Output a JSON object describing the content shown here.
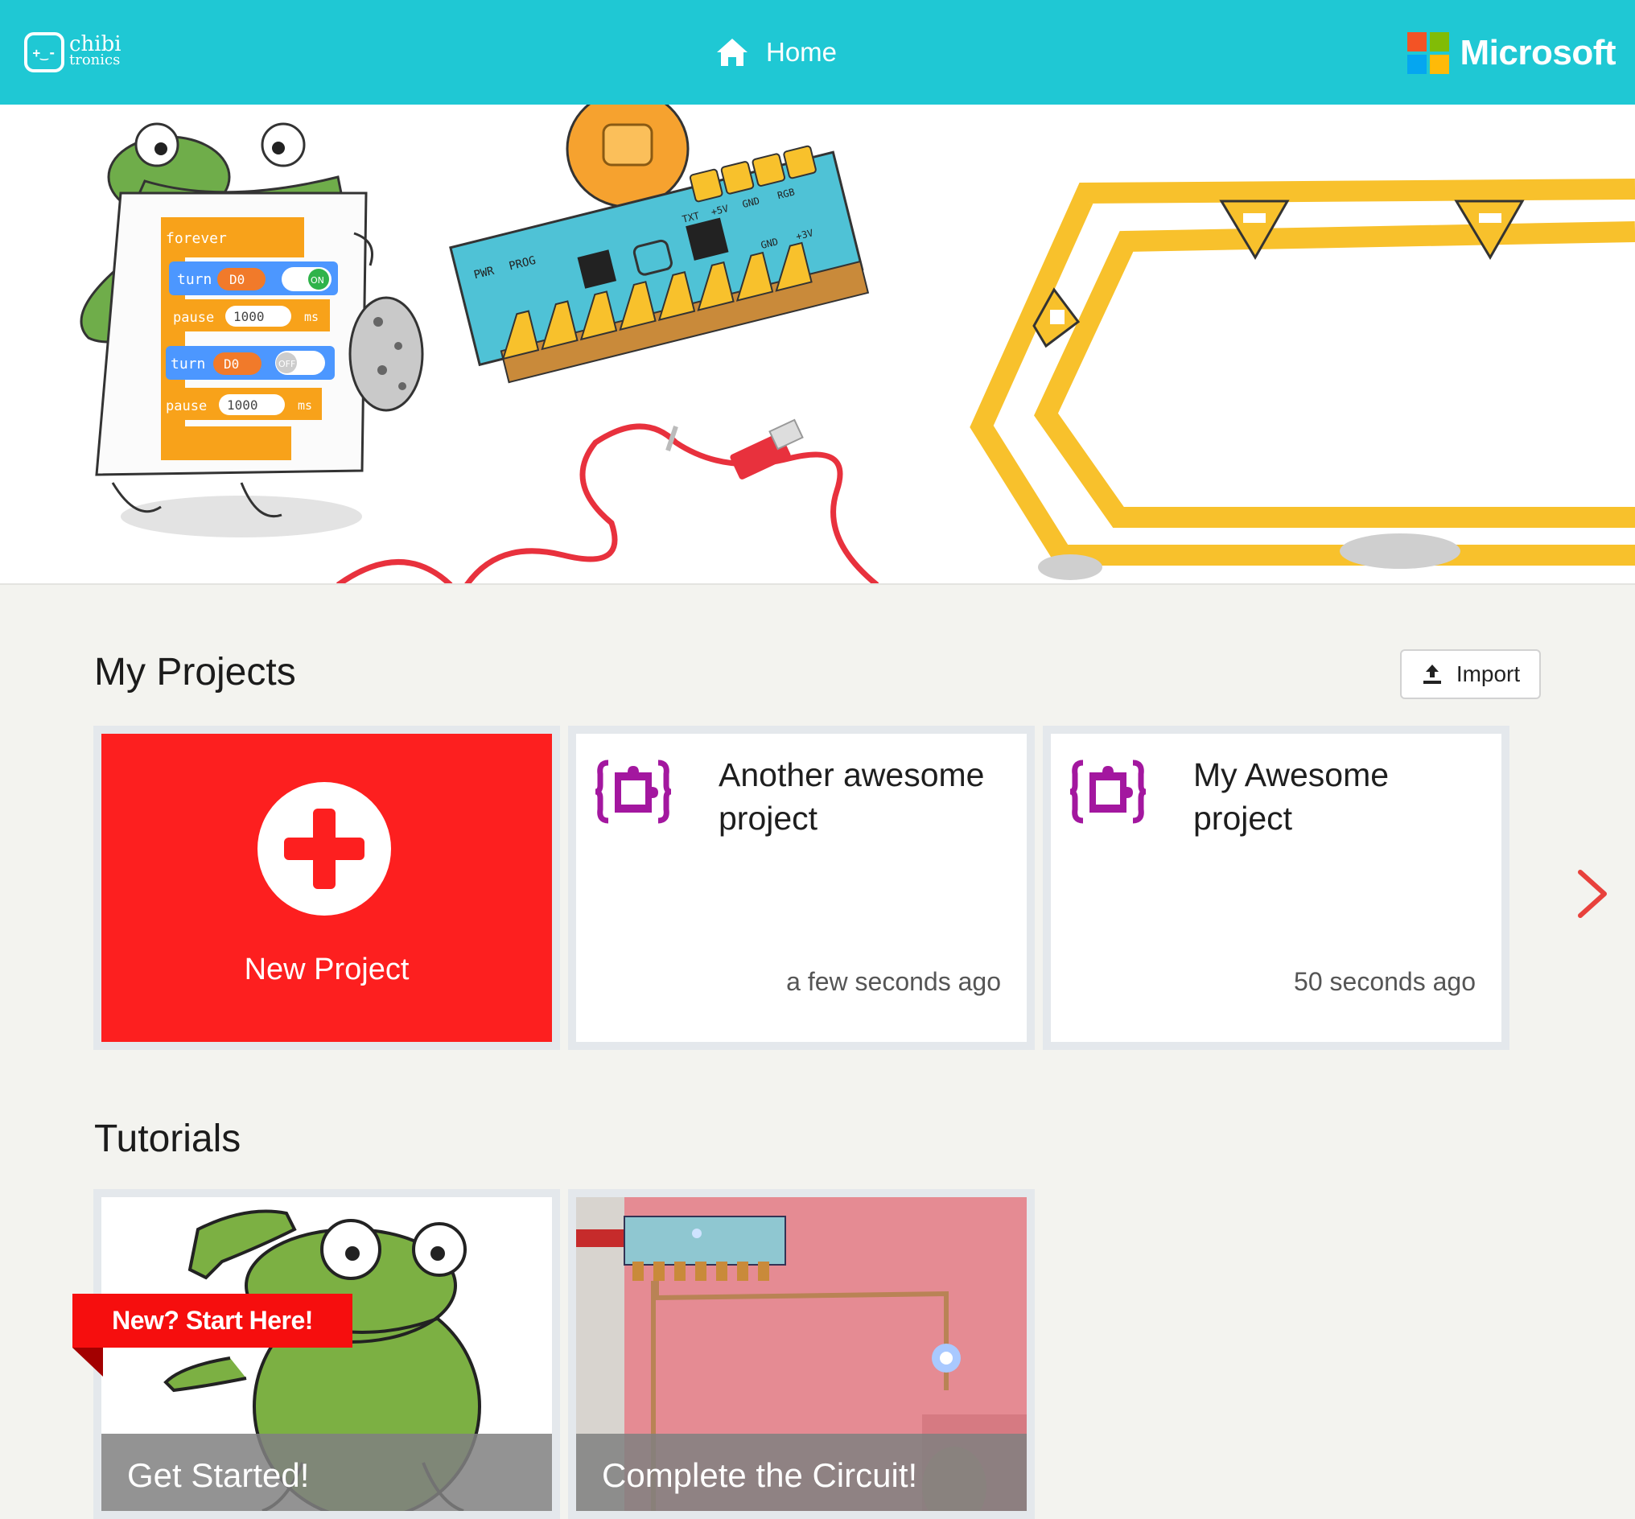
{
  "header": {
    "brand_line1": "chibi",
    "brand_line2": "tronics",
    "brand_face": "+‿-",
    "home_label": "Home",
    "microsoft_label": "Microsoft",
    "ms_colors": [
      "#f35325",
      "#81bc06",
      "#05a6f0",
      "#ffba08"
    ]
  },
  "hero": {
    "blocks": [
      {
        "text": "forever"
      },
      {
        "text": "turn",
        "pin": "D0",
        "toggle": "ON"
      },
      {
        "text": "pause",
        "value": "1000",
        "unit": "ms"
      },
      {
        "text": "turn",
        "pin": "D0",
        "toggle": "OFF"
      },
      {
        "text": "pause",
        "value": "1000",
        "unit": "ms"
      }
    ],
    "board_labels": [
      "PWR",
      "PROG",
      "TXT",
      "+5V",
      "GND",
      "RGB",
      "GND",
      "+3V"
    ]
  },
  "my_projects": {
    "title": "My Projects",
    "import_label": "Import",
    "new_project_label": "New Project",
    "projects": [
      {
        "title": "Another awesome project",
        "time": "a few seconds ago"
      },
      {
        "title": "My Awesome project",
        "time": "50 seconds ago"
      }
    ]
  },
  "tutorials": {
    "title": "Tutorials",
    "ribbon": "New? Start Here!",
    "items": [
      {
        "label": "Get Started!"
      },
      {
        "label": "Complete the Circuit!"
      }
    ]
  },
  "colors": {
    "header_bg": "#1fc8d4",
    "new_project_bg": "#fd1f1f",
    "project_icon": "#a3179f",
    "arrow": "#e8413c"
  }
}
